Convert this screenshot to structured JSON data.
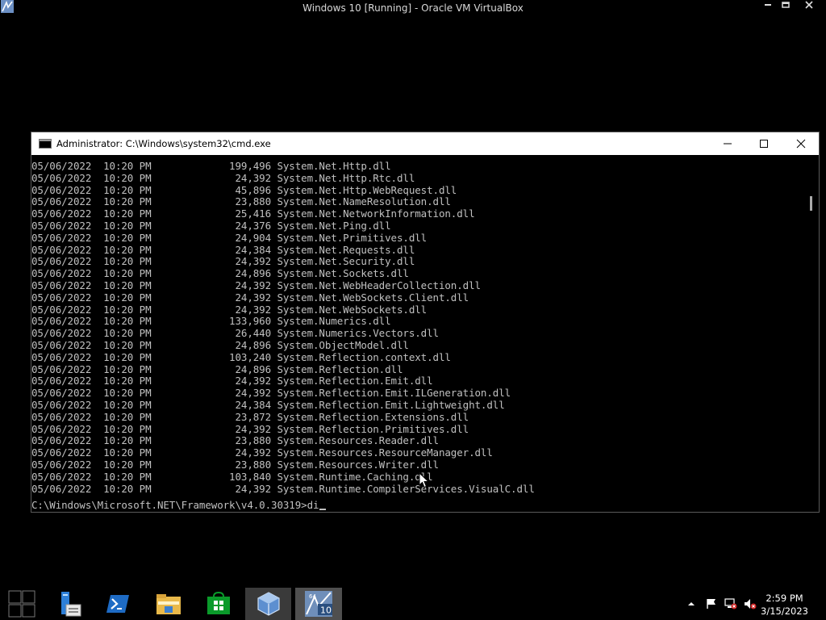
{
  "host_window": {
    "title": "Windows 10 [Running] - Oracle VM VirtualBox",
    "icon": "virtualbox-icon",
    "controls": [
      "minimize-icon",
      "restore-icon",
      "close-icon"
    ]
  },
  "cmd": {
    "title": "Administrator: C:\\Windows\\system32\\cmd.exe",
    "rows": [
      {
        "date": "05/06/2022",
        "time": "10:20 PM",
        "size": "199,496",
        "name": "System.Net.Http.dll"
      },
      {
        "date": "05/06/2022",
        "time": "10:20 PM",
        "size": "24,392",
        "name": "System.Net.Http.Rtc.dll"
      },
      {
        "date": "05/06/2022",
        "time": "10:20 PM",
        "size": "45,896",
        "name": "System.Net.Http.WebRequest.dll"
      },
      {
        "date": "05/06/2022",
        "time": "10:20 PM",
        "size": "23,880",
        "name": "System.Net.NameResolution.dll"
      },
      {
        "date": "05/06/2022",
        "time": "10:20 PM",
        "size": "25,416",
        "name": "System.Net.NetworkInformation.dll"
      },
      {
        "date": "05/06/2022",
        "time": "10:20 PM",
        "size": "24,376",
        "name": "System.Net.Ping.dll"
      },
      {
        "date": "05/06/2022",
        "time": "10:20 PM",
        "size": "24,904",
        "name": "System.Net.Primitives.dll"
      },
      {
        "date": "05/06/2022",
        "time": "10:20 PM",
        "size": "24,384",
        "name": "System.Net.Requests.dll"
      },
      {
        "date": "05/06/2022",
        "time": "10:20 PM",
        "size": "24,392",
        "name": "System.Net.Security.dll"
      },
      {
        "date": "05/06/2022",
        "time": "10:20 PM",
        "size": "24,896",
        "name": "System.Net.Sockets.dll"
      },
      {
        "date": "05/06/2022",
        "time": "10:20 PM",
        "size": "24,392",
        "name": "System.Net.WebHeaderCollection.dll"
      },
      {
        "date": "05/06/2022",
        "time": "10:20 PM",
        "size": "24,392",
        "name": "System.Net.WebSockets.Client.dll"
      },
      {
        "date": "05/06/2022",
        "time": "10:20 PM",
        "size": "24,392",
        "name": "System.Net.WebSockets.dll"
      },
      {
        "date": "05/06/2022",
        "time": "10:20 PM",
        "size": "133,960",
        "name": "System.Numerics.dll"
      },
      {
        "date": "05/06/2022",
        "time": "10:20 PM",
        "size": "26,440",
        "name": "System.Numerics.Vectors.dll"
      },
      {
        "date": "05/06/2022",
        "time": "10:20 PM",
        "size": "24,896",
        "name": "System.ObjectModel.dll"
      },
      {
        "date": "05/06/2022",
        "time": "10:20 PM",
        "size": "103,240",
        "name": "System.Reflection.context.dll"
      },
      {
        "date": "05/06/2022",
        "time": "10:20 PM",
        "size": "24,896",
        "name": "System.Reflection.dll"
      },
      {
        "date": "05/06/2022",
        "time": "10:20 PM",
        "size": "24,392",
        "name": "System.Reflection.Emit.dll"
      },
      {
        "date": "05/06/2022",
        "time": "10:20 PM",
        "size": "24,392",
        "name": "System.Reflection.Emit.ILGeneration.dll"
      },
      {
        "date": "05/06/2022",
        "time": "10:20 PM",
        "size": "24,384",
        "name": "System.Reflection.Emit.Lightweight.dll"
      },
      {
        "date": "05/06/2022",
        "time": "10:20 PM",
        "size": "23,872",
        "name": "System.Reflection.Extensions.dll"
      },
      {
        "date": "05/06/2022",
        "time": "10:20 PM",
        "size": "24,392",
        "name": "System.Reflection.Primitives.dll"
      },
      {
        "date": "05/06/2022",
        "time": "10:20 PM",
        "size": "23,880",
        "name": "System.Resources.Reader.dll"
      },
      {
        "date": "05/06/2022",
        "time": "10:20 PM",
        "size": "24,392",
        "name": "System.Resources.ResourceManager.dll"
      },
      {
        "date": "05/06/2022",
        "time": "10:20 PM",
        "size": "23,880",
        "name": "System.Resources.Writer.dll"
      },
      {
        "date": "05/06/2022",
        "time": "10:20 PM",
        "size": "103,840",
        "name": "System.Runtime.Caching.dll"
      },
      {
        "date": "05/06/2022",
        "time": "10:20 PM",
        "size": "24,392",
        "name": "System.Runtime.CompilerServices.VisualC.dll"
      }
    ],
    "prompt": "C:\\Windows\\Microsoft.NET\\Framework\\v4.0.30319>",
    "typed": "di"
  },
  "taskbar": {
    "items": [
      {
        "name": "start-icon"
      },
      {
        "name": "server-manager-icon"
      },
      {
        "name": "powershell-icon"
      },
      {
        "name": "file-explorer-icon"
      },
      {
        "name": "store-icon"
      },
      {
        "name": "virtualbox-icon"
      },
      {
        "name": "vm-windows10-icon",
        "badge_top": "64",
        "badge": "10"
      }
    ],
    "tray": [
      "show-hidden-icons-icon",
      "action-center-flag-icon",
      "network-icon",
      "volume-muted-icon"
    ],
    "time": "2:59 PM",
    "date": "3/15/2023"
  }
}
